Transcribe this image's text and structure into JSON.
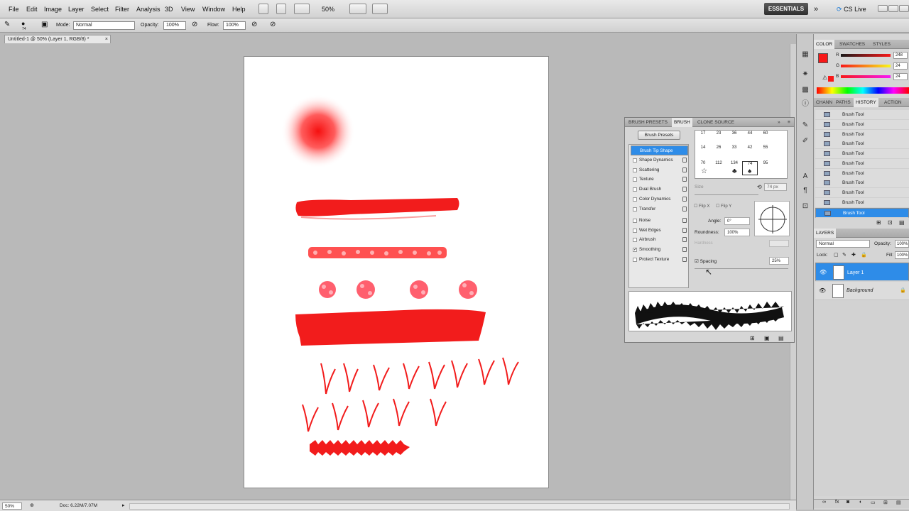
{
  "menu": [
    "File",
    "Edit",
    "Image",
    "Layer",
    "Select",
    "Filter",
    "Analysis",
    "3D",
    "View",
    "Window",
    "Help"
  ],
  "toolbar": {
    "zoom": "50%",
    "workspace": "ESSENTIALS",
    "cslive": "CS Live"
  },
  "options": {
    "brush_size": "74",
    "mode_label": "Mode:",
    "mode": "Normal",
    "opacity_label": "Opacity:",
    "opacity": "100%",
    "flow_label": "Flow:",
    "flow": "100%"
  },
  "document": {
    "tab": "Untitled-1 @ 50% (Layer 1, RGB/8) *"
  },
  "status": {
    "zoom": "50%",
    "doc": "Doc: 6.22M/7.07M"
  },
  "color_panel": {
    "tabs": [
      "COLOR",
      "SWATCHES",
      "STYLES"
    ],
    "r_label": "R",
    "g_label": "G",
    "b_label": "B",
    "r": "248",
    "g": "24",
    "b": "24",
    "fg": "#f81818"
  },
  "history_panel": {
    "tabs": [
      "CHANN",
      "PATHS",
      "HISTORY",
      "ACTION"
    ],
    "items": [
      "Brush Tool",
      "Brush Tool",
      "Brush Tool",
      "Brush Tool",
      "Brush Tool",
      "Brush Tool",
      "Brush Tool",
      "Brush Tool",
      "Brush Tool",
      "Brush Tool",
      "Brush Tool"
    ]
  },
  "layers_panel": {
    "title": "LAYERS",
    "blend": "Normal",
    "opacity_label": "Opacity:",
    "opacity": "100%",
    "lock_label": "Lock:",
    "fill_label": "Fill:",
    "fill": "100%",
    "layers": [
      "Layer 1",
      "Background"
    ]
  },
  "brush_panel": {
    "tabs": [
      "BRUSH PRESETS",
      "BRUSH",
      "CLONE SOURCE"
    ],
    "presets_button": "Brush Presets",
    "options": [
      {
        "label": "Brush Tip Shape",
        "checked": false,
        "selected": true
      },
      {
        "label": "Shape Dynamics",
        "checked": false
      },
      {
        "label": "Scattering",
        "checked": false
      },
      {
        "label": "Texture",
        "checked": false
      },
      {
        "label": "Dual Brush",
        "checked": false
      },
      {
        "label": "Color Dynamics",
        "checked": false
      },
      {
        "label": "Transfer",
        "checked": false
      },
      {
        "label": "Noise",
        "checked": false
      },
      {
        "label": "Wet Edges",
        "checked": false
      },
      {
        "label": "Airbrush",
        "checked": false
      },
      {
        "label": "Smoothing",
        "checked": true
      },
      {
        "label": "Protect Texture",
        "checked": false
      }
    ],
    "tip_sizes_row1": [
      "17",
      "23",
      "36",
      "44",
      "60"
    ],
    "tip_sizes_row2": [
      "14",
      "26",
      "33",
      "42",
      "55"
    ],
    "tip_sizes_row3": [
      "70",
      "112",
      "134",
      "74",
      "95"
    ],
    "size_label": "Size",
    "size_value": "74 px",
    "flipx": "Flip X",
    "flipy": "Flip Y",
    "angle_label": "Angle:",
    "angle": "0°",
    "roundness_label": "Roundness:",
    "roundness": "100%",
    "hardness_label": "Hardness",
    "spacing_label": "Spacing",
    "spacing": "25%"
  }
}
